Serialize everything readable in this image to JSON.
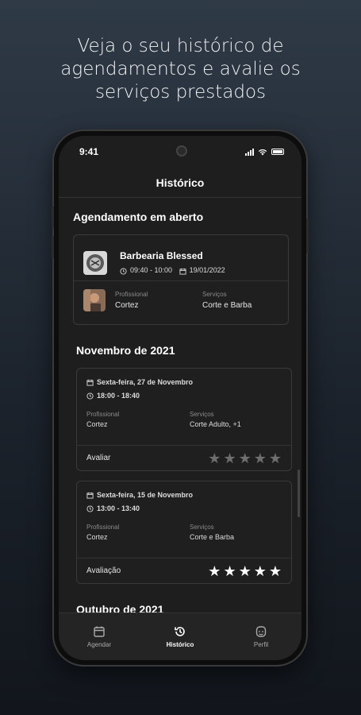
{
  "headline": {
    "line1": "Veja o seu histórico de",
    "line2": "agendamentos e avalie os",
    "line3": "serviços prestados"
  },
  "status": {
    "time": "9:41"
  },
  "nav": {
    "title": "Histórico"
  },
  "open": {
    "section_title": "Agendamento em aberto",
    "shop_name": "Barbearia Blessed",
    "time": "09:40 - 10:00",
    "date": "19/01/2022",
    "professional_label": "Profissional",
    "professional": "Cortez",
    "services_label": "Serviços",
    "services": "Corte e Barba"
  },
  "november": {
    "section_title": "Novembro de 2021",
    "items": [
      {
        "date": "Sexta-feira, 27 de Novembro",
        "time": "18:00 - 18:40",
        "professional_label": "Profissional",
        "professional": "Cortez",
        "services_label": "Serviços",
        "services": "Corte Adulto, +1",
        "rating_label": "Avaliar",
        "rating": 0
      },
      {
        "date": "Sexta-feira, 15 de Novembro",
        "time": "13:00 - 13:40",
        "professional_label": "Profissional",
        "professional": "Cortez",
        "services_label": "Serviços",
        "services": "Corte e Barba",
        "rating_label": "Avaliação",
        "rating": 5
      }
    ]
  },
  "october": {
    "section_title": "Outubro de 2021"
  },
  "tabs": [
    {
      "label": "Agendar",
      "icon": "calendar-icon",
      "active": false
    },
    {
      "label": "Histórico",
      "icon": "history-icon",
      "active": true
    },
    {
      "label": "Perfil",
      "icon": "profile-icon",
      "active": false
    }
  ],
  "colors": {
    "star_filled": "#ffffff",
    "star_empty": "#6e6e6e",
    "background": "#1e1e1e"
  }
}
